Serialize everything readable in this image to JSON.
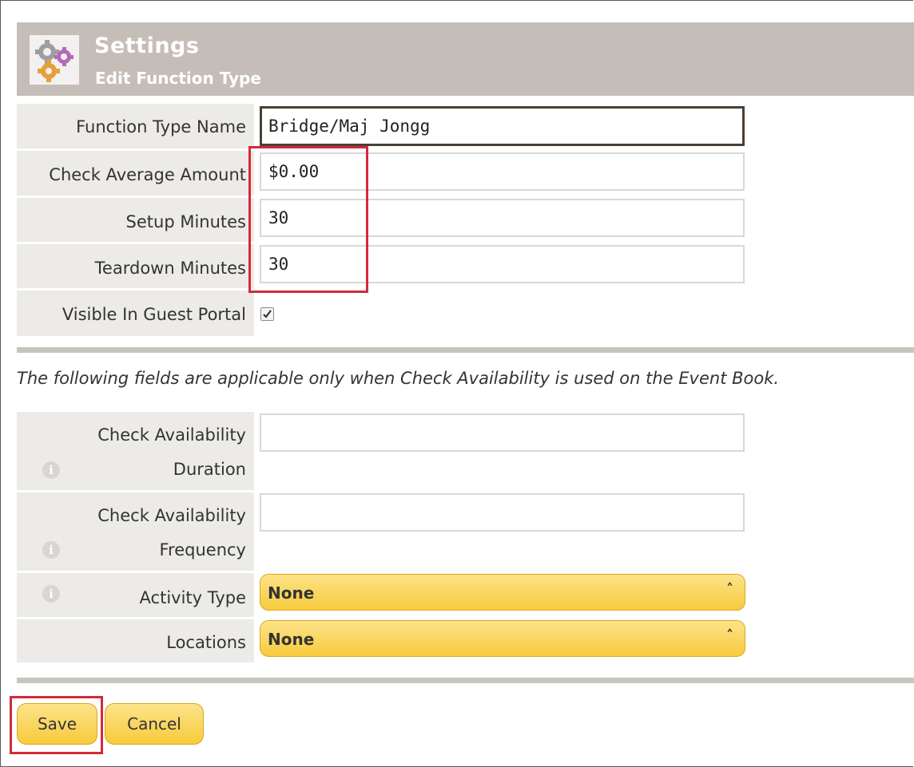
{
  "header": {
    "title": "Settings",
    "subtitle": "Edit Function Type",
    "icon": "gears-icon"
  },
  "form": {
    "function_type_name": {
      "label": "Function Type Name",
      "value": "Bridge/Maj Jongg"
    },
    "check_average_amount": {
      "label": "Check Average Amount",
      "value": "$0.00"
    },
    "setup_minutes": {
      "label": "Setup Minutes",
      "value": "30"
    },
    "teardown_minutes": {
      "label": "Teardown Minutes",
      "value": "30"
    },
    "visible_in_guest_portal": {
      "label": "Visible In Guest Portal",
      "checked": true
    }
  },
  "availability": {
    "note": "The following fields are applicable only when Check Availability is used on the Event Book.",
    "duration": {
      "label_line1": "Check Availability",
      "label_line2": "Duration",
      "value": ""
    },
    "frequency": {
      "label_line1": "Check Availability",
      "label_line2": "Frequency",
      "value": ""
    },
    "activity_type": {
      "label": "Activity Type",
      "value": "None"
    },
    "locations": {
      "label": "Locations",
      "value": "None"
    }
  },
  "buttons": {
    "save": "Save",
    "cancel": "Cancel"
  },
  "colors": {
    "header_bg": "#c5beb8",
    "label_bg": "#ecebe7",
    "button_gold": "#f7cb3c",
    "highlight_red": "#d32a3a"
  }
}
